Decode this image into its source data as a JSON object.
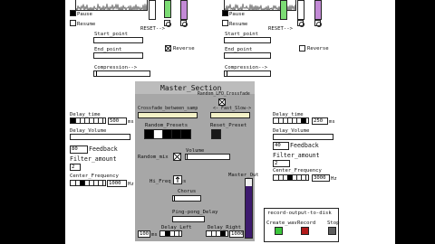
{
  "colors": {
    "green": "#7cdc74",
    "purple": "#c38ad6",
    "master_bg": "#a7a7a7",
    "master_header": "#bcbcbc",
    "vu_purple": "#3d1a6e",
    "vu_bg": "#efefef",
    "wave": "#444444"
  },
  "left_deck": {
    "pause": "Pause",
    "resume": "Resume",
    "reset": "RESET-->",
    "start_point": "Start_point",
    "end_point": "End_point",
    "reverse": "Reverse",
    "compression": "Compression-->"
  },
  "right_deck": {
    "pause": "Pause",
    "resume": "Resume",
    "reset": "RESET-->",
    "start_point": "Start_point",
    "end_point": "End_point",
    "reverse": "Reverse",
    "compression": "Compression-->"
  },
  "left_fx": {
    "delay_time": "Delay_time",
    "delay_time_value": "500",
    "ms": "ms",
    "delay_volume": "Delay_Volume",
    "feedback_value": "80",
    "feedback": "Feedback",
    "filter_amount": "Filter_amount",
    "filter_value": "2",
    "center_frequency": "Center_Frequency",
    "cf_value": "1000",
    "hz": "Hz"
  },
  "right_fx": {
    "delay_time": "Delay_time",
    "delay_time_value": "250",
    "ms": "ms",
    "delay_volume": "Delay_Volume",
    "feedback_value": "40",
    "feedback": "Feedback",
    "filter_amount": "Filter_amount",
    "filter_value": "2",
    "center_frequency": "Center_Frequency",
    "cf_value": "3000",
    "hz": "Hz"
  },
  "master": {
    "title": "Master_Section",
    "random_crossfade": "Random_LFO_Crossfade",
    "crossfade_between_samp": "Crossfade_between_samp",
    "fast_slow": "<- Fast_Slow->",
    "random_presets": "Random_Presets",
    "reset_preset": "Reset_Preset",
    "random_mix": "Random_mix",
    "volume": "Volume",
    "hi_freq_loss": "Hi_Freq_Loss",
    "chorus": "Chorus",
    "ping_pong_delay": "Ping-pong_Delay",
    "delay_left": "Delay_Left",
    "delay_right": "Delay_Right",
    "dl_value": "100",
    "dr_value": "1000",
    "ms": "ms",
    "master_out": "Master_Out"
  },
  "recorder": {
    "title": "record-output-to-disk",
    "create_wav": "Create_wav",
    "record": "Record",
    "stop": "Stop"
  }
}
